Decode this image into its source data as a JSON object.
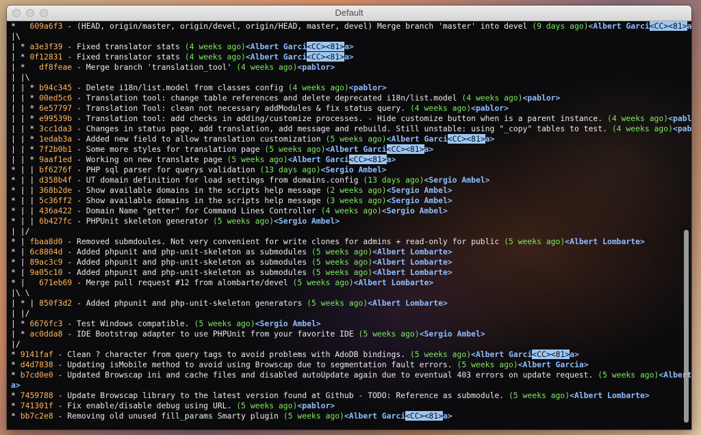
{
  "window": {
    "title": "Default"
  },
  "lines": [
    {
      "graph": "*   ",
      "hash": "609a6f3",
      "msg": " - (HEAD, origin/master, origin/devel, origin/HEAD, master, devel) Merge branch 'master' into devel ",
      "date": "(9 days ago)",
      "author": "Albert Garci",
      "esc": "<CC><81>",
      "tail": "a>"
    },
    {
      "graph": "|\\",
      "hash": "",
      "msg": "",
      "date": "",
      "author": "",
      "esc": "",
      "tail": ""
    },
    {
      "graph": "| * ",
      "hash": "a3e3f39",
      "msg": " - Fixed translator stats ",
      "date": "(4 weeks ago)",
      "author": "Albert Garci",
      "esc": "<CC><81>",
      "tail": "a>"
    },
    {
      "graph": "| * ",
      "hash": "0f12831",
      "msg": " - Fixed translator stats ",
      "date": "(4 weeks ago)",
      "author": "Albert Garci",
      "esc": "<CC><81>",
      "tail": "a>"
    },
    {
      "graph": "| *   ",
      "hash": "df8feae",
      "msg": " - Merge branch 'translation_tool' ",
      "date": "(4 weeks ago)",
      "author": "pablor",
      "esc": "",
      "tail": ""
    },
    {
      "graph": "| |\\",
      "hash": "",
      "msg": "",
      "date": "",
      "author": "",
      "esc": "",
      "tail": ""
    },
    {
      "graph": "| | * ",
      "hash": "b94c345",
      "msg": " - Delete i18n/list.model from classes config ",
      "date": "(4 weeks ago)",
      "author": "pablor",
      "esc": "",
      "tail": ""
    },
    {
      "graph": "| | * ",
      "hash": "00ed5c6",
      "msg": " - Translation tool: change table references and delete deprecated i18n/list.model ",
      "date": "(4 weeks ago)",
      "author": "pablor",
      "esc": "",
      "tail": ""
    },
    {
      "graph": "| | * ",
      "hash": "6e57797",
      "msg": " - Translation Tool: clean not necessary addModules & fix status query. ",
      "date": "(4 weeks ago)",
      "author": "pablor",
      "esc": "",
      "tail": ""
    },
    {
      "graph": "| | * ",
      "hash": "e99539b",
      "msg": " - Translation tool: add checks in adding/customize processes. - Hide customize button when is a parent instance. ",
      "date": "(4 weeks ago)",
      "author": "pablor",
      "esc": "",
      "tail": ""
    },
    {
      "graph": "| | * ",
      "hash": "3cc1da3",
      "msg": " - Changes in status page, add translation, add message and rebuild. Still unstable: using \"_copy\" tables to test. ",
      "date": "(4 weeks ago)",
      "author": "pablor",
      "esc": "",
      "tail": ""
    },
    {
      "graph": "| | * ",
      "hash": "1edab3a",
      "msg": " - Added new field to allow translation customization ",
      "date": "(5 weeks ago)",
      "author": "Albert Garci",
      "esc": "<CC><81>",
      "tail": "a>"
    },
    {
      "graph": "| | * ",
      "hash": "7f2b0b1",
      "msg": " - Some more styles for translation page ",
      "date": "(5 weeks ago)",
      "author": "Albert Garci",
      "esc": "<CC><81>",
      "tail": "a>"
    },
    {
      "graph": "| | * ",
      "hash": "9aaf1ed",
      "msg": " - Working on new translate page ",
      "date": "(5 weeks ago)",
      "author": "Albert Garci",
      "esc": "<CC><81>",
      "tail": "a>"
    },
    {
      "graph": "* | | ",
      "hash": "bf6276f",
      "msg": " - PHP sql parser for querys validation ",
      "date": "(13 days ago)",
      "author": "Sergio Ambel",
      "esc": "",
      "tail": ""
    },
    {
      "graph": "* | | ",
      "hash": "d358b4f",
      "msg": " - UT domain definition for load settings from domains.config ",
      "date": "(13 days ago)",
      "author": "Sergio Ambel",
      "esc": "",
      "tail": ""
    },
    {
      "graph": "* | | ",
      "hash": "368b2de",
      "msg": " - Show available domains in the scripts help message ",
      "date": "(2 weeks ago)",
      "author": "Sergio Ambel",
      "esc": "",
      "tail": ""
    },
    {
      "graph": "* | | ",
      "hash": "5c36ff2",
      "msg": " - Show available domains in the scripts help message ",
      "date": "(3 weeks ago)",
      "author": "Sergio Ambel",
      "esc": "",
      "tail": ""
    },
    {
      "graph": "* | | ",
      "hash": "436a422",
      "msg": " - Domain Name \"getter\" for Command Lines Controller ",
      "date": "(4 weeks ago)",
      "author": "Sergio Ambel",
      "esc": "",
      "tail": ""
    },
    {
      "graph": "* | | ",
      "hash": "6b427fc",
      "msg": " - PHPUnit skeleton generator ",
      "date": "(5 weeks ago)",
      "author": "Sergio Ambel",
      "esc": "",
      "tail": ""
    },
    {
      "graph": "| |/",
      "hash": "",
      "msg": "",
      "date": "",
      "author": "",
      "esc": "",
      "tail": ""
    },
    {
      "graph": "* | ",
      "hash": "fbaa8d0",
      "msg": " - Removed submdoules. Not very convenient for write clones for admins + read-only for public ",
      "date": "(5 weeks ago)",
      "author": "Albert Lombarte",
      "esc": "",
      "tail": ""
    },
    {
      "graph": "* | ",
      "hash": "6c8804d",
      "msg": " - Added phpunit and php-unit-skeleton as submodules ",
      "date": "(5 weeks ago)",
      "author": "Albert Lombarte",
      "esc": "",
      "tail": ""
    },
    {
      "graph": "* | ",
      "hash": "89ac3c9",
      "msg": " - Added phpunit and php-unit-skeleton as submodules ",
      "date": "(5 weeks ago)",
      "author": "Albert Lombarte",
      "esc": "",
      "tail": ""
    },
    {
      "graph": "* | ",
      "hash": "9a05c10",
      "msg": " - Added phpunit and php-unit-skeleton as submodules ",
      "date": "(5 weeks ago)",
      "author": "Albert Lombarte",
      "esc": "",
      "tail": ""
    },
    {
      "graph": "* |   ",
      "hash": "671eb69",
      "msg": " - Merge pull request #12 from alombarte/devel ",
      "date": "(5 weeks ago)",
      "author": "Albert Lombarte",
      "esc": "",
      "tail": ""
    },
    {
      "graph": "|\\ \\",
      "hash": "",
      "msg": "",
      "date": "",
      "author": "",
      "esc": "",
      "tail": ""
    },
    {
      "graph": "| * | ",
      "hash": "850f3d2",
      "msg": " - Added phpunit and php-unit-skeleton generators ",
      "date": "(5 weeks ago)",
      "author": "Albert Lombarte",
      "esc": "",
      "tail": ""
    },
    {
      "graph": "| |/",
      "hash": "",
      "msg": "",
      "date": "",
      "author": "",
      "esc": "",
      "tail": ""
    },
    {
      "graph": "| * ",
      "hash": "6676fc3",
      "msg": " - Test Windows compatible. ",
      "date": "(5 weeks ago)",
      "author": "Sergio Ambel",
      "esc": "",
      "tail": ""
    },
    {
      "graph": "| * ",
      "hash": "ac0dda8",
      "msg": " - IDE Bootstrap adapter to use PHPUnit from your favorite IDE ",
      "date": "(5 weeks ago)",
      "author": "Sergio Ambel",
      "esc": "",
      "tail": ""
    },
    {
      "graph": "|/",
      "hash": "",
      "msg": "",
      "date": "",
      "author": "",
      "esc": "",
      "tail": ""
    },
    {
      "graph": "* ",
      "hash": "9141faf",
      "msg": " - Clean ? character from query tags to avoid problems with AdoDB bindings. ",
      "date": "(5 weeks ago)",
      "author": "Albert Garci",
      "esc": "<CC><81>",
      "tail": "a>"
    },
    {
      "graph": "* ",
      "hash": "d4d7838",
      "msg": " - Updating isMobile method to avoid using Browscap due to segmentation fault errors. ",
      "date": "(5 weeks ago)",
      "author": "Albert Garcia",
      "esc": "",
      "tail": ""
    },
    {
      "graph": "* ",
      "hash": "b7cd0e0",
      "msg": " - Updated Browscap ini and cache files and disabled autoUpdate again due to eventual 403 errors on update request. ",
      "date": "(5 weeks ago)",
      "author": "Albert Garci",
      "esc": "",
      "tail": ""
    },
    {
      "graph": "",
      "hash": "",
      "msg": "",
      "date": "",
      "author": "",
      "esc": "",
      "tail": "a>"
    },
    {
      "graph": "* ",
      "hash": "7459788",
      "msg": " - Update Browscap library to the latest version found at Github - TODO: Reference as submodule. ",
      "date": "(5 weeks ago)",
      "author": "Albert Lombarte",
      "esc": "",
      "tail": ""
    },
    {
      "graph": "* ",
      "hash": "741301f",
      "msg": " - Fix enable/disable debug using URL. ",
      "date": "(5 weeks ago)",
      "author": "pablor",
      "esc": "",
      "tail": ""
    },
    {
      "graph": "* ",
      "hash": "bb7c2e8",
      "msg": " - Removing old unused fill_params Smarty plugin ",
      "date": "(5 weeks ago)",
      "author": "Albert Garci",
      "esc": "<CC><81>",
      "tail": "a>"
    }
  ]
}
